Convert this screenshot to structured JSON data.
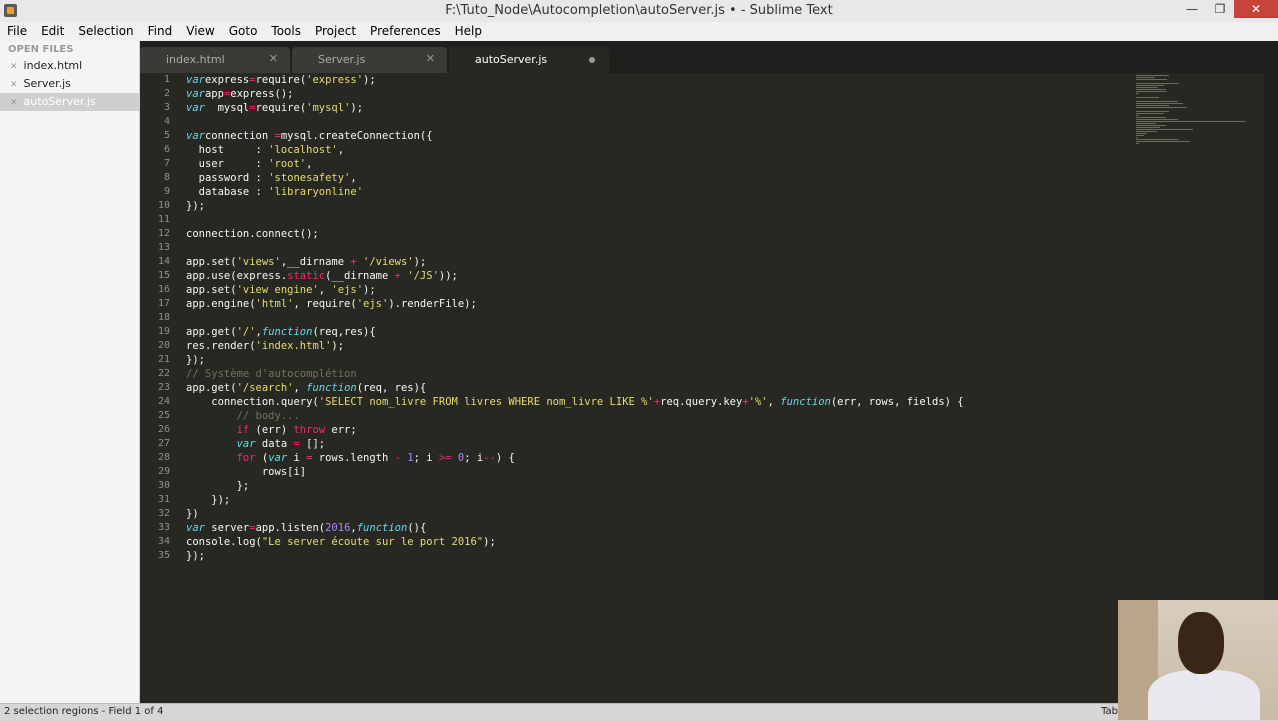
{
  "window": {
    "title": "F:\\Tuto_Node\\Autocompletion\\autoServer.js • - Sublime Text"
  },
  "menu": [
    "File",
    "Edit",
    "Selection",
    "Find",
    "View",
    "Goto",
    "Tools",
    "Project",
    "Preferences",
    "Help"
  ],
  "sidebar": {
    "header": "OPEN FILES",
    "files": [
      "index.html",
      "Server.js",
      "autoServer.js"
    ],
    "active_index": 2
  },
  "tabs": [
    {
      "label": "index.html",
      "state": "close"
    },
    {
      "label": "Server.js",
      "state": "close"
    },
    {
      "label": "autoServer.js",
      "state": "modified",
      "active": true
    }
  ],
  "editor": {
    "line_numbers": [
      "1",
      "2",
      "3",
      "4",
      "5",
      "6",
      "7",
      "8",
      "9",
      "10",
      "11",
      "12",
      "13",
      "14",
      "15",
      "16",
      "17",
      "18",
      "19",
      "20",
      "21",
      "22",
      "23",
      "24",
      "25",
      "26",
      "27",
      "28",
      "29",
      "30",
      "31",
      "32",
      "33",
      "34",
      "35"
    ],
    "lines": [
      [
        [
          "kw",
          "var"
        ],
        [
          "",
          "express"
        ],
        [
          "op",
          "="
        ],
        [
          "",
          "require("
        ],
        [
          "st",
          "'express'"
        ],
        [
          "",
          ");"
        ]
      ],
      [
        [
          "kw",
          "var"
        ],
        [
          "",
          "app"
        ],
        [
          "op",
          "="
        ],
        [
          "",
          "express();"
        ]
      ],
      [
        [
          "kw",
          "var"
        ],
        [
          "",
          "  mysql"
        ],
        [
          "op",
          "="
        ],
        [
          "",
          "require("
        ],
        [
          "st",
          "'mysql'"
        ],
        [
          "",
          ");"
        ]
      ],
      [],
      [
        [
          "kw",
          "var"
        ],
        [
          "",
          "connection "
        ],
        [
          "op",
          "="
        ],
        [
          "",
          "mysql.createConnection({"
        ]
      ],
      [
        [
          "",
          "  host     : "
        ],
        [
          "st",
          "'localhost'"
        ],
        [
          "",
          ","
        ]
      ],
      [
        [
          "",
          "  user     : "
        ],
        [
          "st",
          "'root'"
        ],
        [
          "",
          ","
        ]
      ],
      [
        [
          "",
          "  password : "
        ],
        [
          "st",
          "'stonesafety'"
        ],
        [
          "",
          ","
        ]
      ],
      [
        [
          "",
          "  database : "
        ],
        [
          "st",
          "'libraryonline'"
        ]
      ],
      [
        [
          "",
          "});"
        ]
      ],
      [],
      [
        [
          "",
          "connection.connect();"
        ]
      ],
      [],
      [
        [
          "",
          "app.set("
        ],
        [
          "st",
          "'views'"
        ],
        [
          "",
          ",__dirname "
        ],
        [
          "op",
          "+"
        ],
        [
          "st",
          " '/views'"
        ],
        [
          "",
          ");"
        ]
      ],
      [
        [
          "",
          "app.use(express."
        ],
        [
          "op",
          "static"
        ],
        [
          "",
          "(__dirname "
        ],
        [
          "op",
          "+"
        ],
        [
          "st",
          " '/JS'"
        ],
        [
          "",
          "));"
        ]
      ],
      [
        [
          "",
          "app.set("
        ],
        [
          "st",
          "'view engine'"
        ],
        [
          "",
          ", "
        ],
        [
          "st",
          "'ejs'"
        ],
        [
          "",
          ");"
        ]
      ],
      [
        [
          "",
          "app.engine("
        ],
        [
          "st",
          "'html'"
        ],
        [
          "",
          ", require("
        ],
        [
          "st",
          "'ejs'"
        ],
        [
          "",
          ").renderFile);"
        ]
      ],
      [],
      [
        [
          "",
          "app.get("
        ],
        [
          "st",
          "'/'"
        ],
        [
          "",
          ","
        ],
        [
          "kw",
          "function"
        ],
        [
          "",
          "(req,res){"
        ]
      ],
      [
        [
          "",
          "res.render("
        ],
        [
          "st",
          "'index.html'"
        ],
        [
          "",
          ");"
        ]
      ],
      [
        [
          "",
          "});"
        ]
      ],
      [
        [
          "cm",
          "// Système d'autocomplétion"
        ]
      ],
      [
        [
          "",
          "app.get("
        ],
        [
          "st",
          "'/search'"
        ],
        [
          "",
          ", "
        ],
        [
          "kw",
          "function"
        ],
        [
          "",
          "(req, res){"
        ]
      ],
      [
        [
          "",
          "    connection.query("
        ],
        [
          "st",
          "'SELECT nom_livre FROM livres WHERE nom_livre LIKE %'"
        ],
        [
          "op",
          "+"
        ],
        [
          "",
          "req.query.key"
        ],
        [
          "op",
          "+"
        ],
        [
          "st",
          "'%'"
        ],
        [
          "",
          ", "
        ],
        [
          "kw",
          "function"
        ],
        [
          "",
          "(err, rows, fields) {"
        ]
      ],
      [
        [
          "cm",
          "        // body..."
        ]
      ],
      [
        [
          "op",
          "        if"
        ],
        [
          "",
          " (err) "
        ],
        [
          "op",
          "throw"
        ],
        [
          "",
          " err;"
        ]
      ],
      [
        [
          "kw",
          "        var"
        ],
        [
          "",
          " data "
        ],
        [
          "op",
          "="
        ],
        [
          "",
          " [];"
        ]
      ],
      [
        [
          "op",
          "        for"
        ],
        [
          "",
          " ("
        ],
        [
          "kw",
          "var"
        ],
        [
          "",
          " i "
        ],
        [
          "op",
          "="
        ],
        [
          "",
          " rows.length "
        ],
        [
          "op",
          "-"
        ],
        [
          "nm",
          " 1"
        ],
        [
          "",
          "; i "
        ],
        [
          "op",
          ">="
        ],
        [
          "nm",
          " 0"
        ],
        [
          "",
          "; i"
        ],
        [
          "op",
          "--"
        ],
        [
          "",
          ") {"
        ]
      ],
      [
        [
          "",
          "            rows[i]"
        ]
      ],
      [
        [
          "",
          "        };"
        ]
      ],
      [
        [
          "",
          "    });"
        ]
      ],
      [
        [
          "",
          "})"
        ]
      ],
      [
        [
          "kw",
          "var"
        ],
        [
          "",
          " server"
        ],
        [
          "op",
          "="
        ],
        [
          "",
          "app.listen("
        ],
        [
          "nm",
          "2016"
        ],
        [
          "",
          ","
        ],
        [
          "kw",
          "function"
        ],
        [
          "",
          "(){"
        ]
      ],
      [
        [
          "",
          "console.log("
        ],
        [
          "st",
          "\"Le server écoute sur le port 2016\""
        ],
        [
          "",
          ");"
        ]
      ],
      [
        [
          "",
          "});"
        ]
      ]
    ]
  },
  "status": {
    "left": "2 selection regions - Field 1 of 4",
    "right": "Tab"
  }
}
